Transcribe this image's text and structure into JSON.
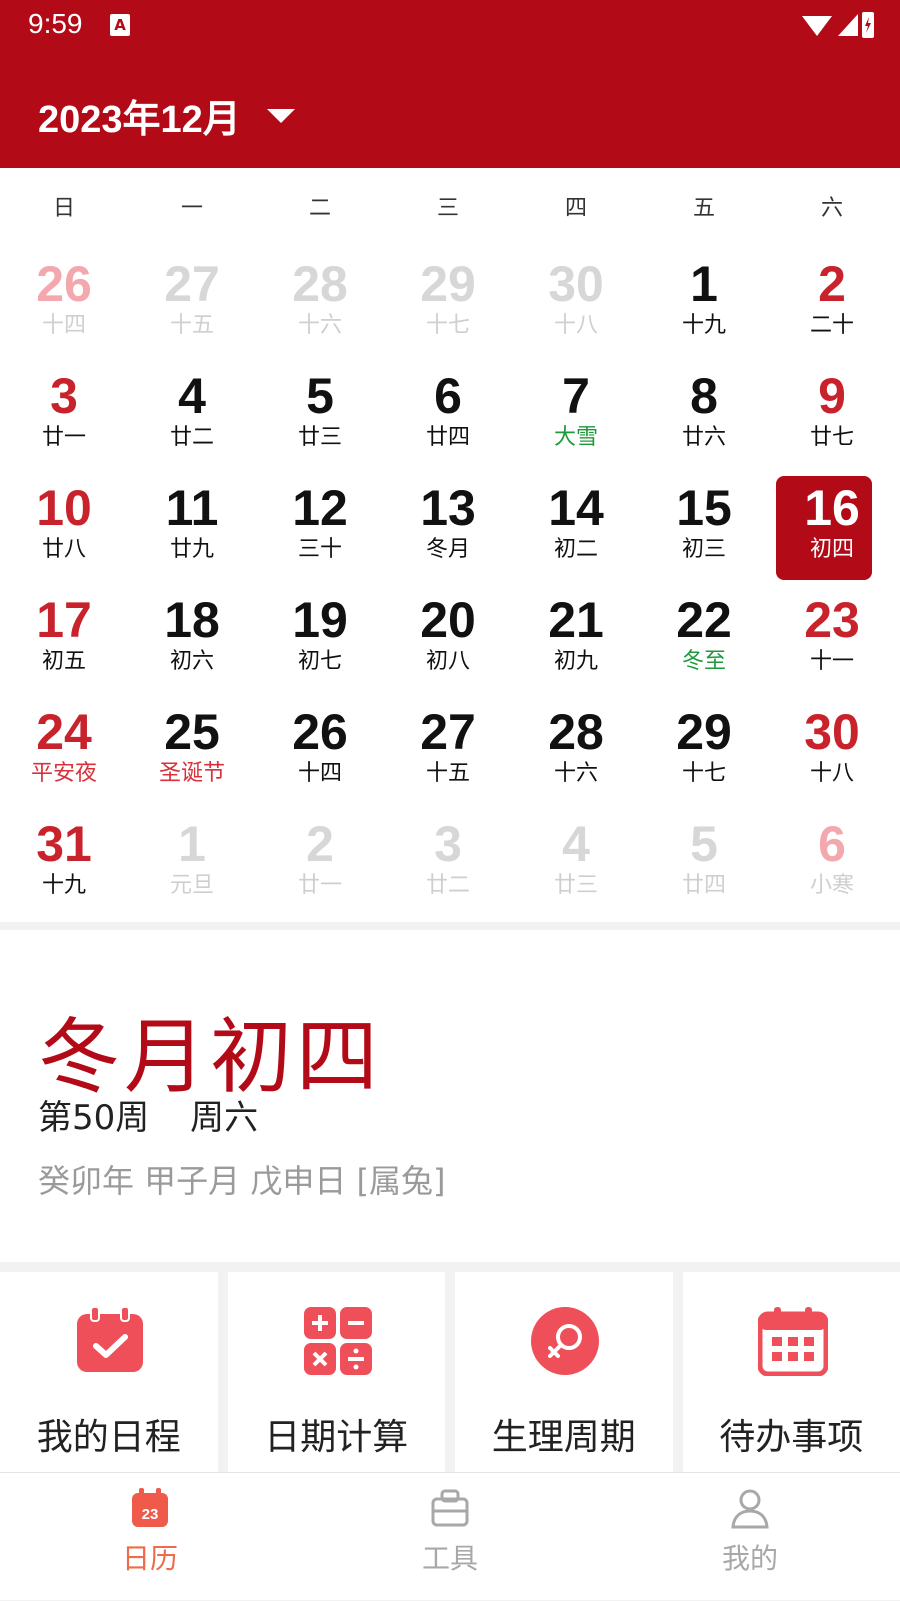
{
  "status_bar": {
    "time": "9:59",
    "notification_icon_letter": "A"
  },
  "header": {
    "month_title": "2023年12月"
  },
  "weekdays": [
    "日",
    "一",
    "二",
    "三",
    "四",
    "五",
    "六"
  ],
  "weeks": [
    [
      {
        "day": "26",
        "lunar": "十四",
        "other": true
      },
      {
        "day": "27",
        "lunar": "十五",
        "other": true
      },
      {
        "day": "28",
        "lunar": "十六",
        "other": true
      },
      {
        "day": "29",
        "lunar": "十七",
        "other": true
      },
      {
        "day": "30",
        "lunar": "十八",
        "other": true
      },
      {
        "day": "1",
        "lunar": "十九"
      },
      {
        "day": "2",
        "lunar": "二十"
      }
    ],
    [
      {
        "day": "3",
        "lunar": "廿一"
      },
      {
        "day": "4",
        "lunar": "廿二"
      },
      {
        "day": "5",
        "lunar": "廿三"
      },
      {
        "day": "6",
        "lunar": "廿四"
      },
      {
        "day": "7",
        "lunar": "大雪",
        "style": "green"
      },
      {
        "day": "8",
        "lunar": "廿六"
      },
      {
        "day": "9",
        "lunar": "廿七"
      }
    ],
    [
      {
        "day": "10",
        "lunar": "廿八"
      },
      {
        "day": "11",
        "lunar": "廿九"
      },
      {
        "day": "12",
        "lunar": "三十"
      },
      {
        "day": "13",
        "lunar": "冬月"
      },
      {
        "day": "14",
        "lunar": "初二"
      },
      {
        "day": "15",
        "lunar": "初三"
      },
      {
        "day": "16",
        "lunar": "初四",
        "selected": true
      }
    ],
    [
      {
        "day": "17",
        "lunar": "初五"
      },
      {
        "day": "18",
        "lunar": "初六"
      },
      {
        "day": "19",
        "lunar": "初七"
      },
      {
        "day": "20",
        "lunar": "初八"
      },
      {
        "day": "21",
        "lunar": "初九"
      },
      {
        "day": "22",
        "lunar": "冬至",
        "style": "green"
      },
      {
        "day": "23",
        "lunar": "十一"
      }
    ],
    [
      {
        "day": "24",
        "lunar": "平安夜",
        "style": "red"
      },
      {
        "day": "25",
        "lunar": "圣诞节",
        "style": "red"
      },
      {
        "day": "26",
        "lunar": "十四"
      },
      {
        "day": "27",
        "lunar": "十五"
      },
      {
        "day": "28",
        "lunar": "十六"
      },
      {
        "day": "29",
        "lunar": "十七"
      },
      {
        "day": "30",
        "lunar": "十八"
      }
    ],
    [
      {
        "day": "31",
        "lunar": "十九"
      },
      {
        "day": "1",
        "lunar": "元旦",
        "other": true
      },
      {
        "day": "2",
        "lunar": "廿一",
        "other": true
      },
      {
        "day": "3",
        "lunar": "廿二",
        "other": true
      },
      {
        "day": "4",
        "lunar": "廿三",
        "other": true
      },
      {
        "day": "5",
        "lunar": "廿四",
        "other": true
      },
      {
        "day": "6",
        "lunar": "小寒",
        "other": true
      }
    ]
  ],
  "info": {
    "lunar_date": "冬月初四",
    "week_number": "第50周",
    "weekday": "周六",
    "ganzhi": "癸卯年 甲子月 戊申日 [属兔]"
  },
  "tools": [
    {
      "label": "我的日程",
      "icon": "calendar-check-icon"
    },
    {
      "label": "日期计算",
      "icon": "calculator-icon"
    },
    {
      "label": "生理周期",
      "icon": "female-symbol-icon"
    },
    {
      "label": "待办事项",
      "icon": "todo-calendar-icon"
    }
  ],
  "tabs": [
    {
      "label": "日历",
      "icon": "calendar-23-icon",
      "icon_text": "23",
      "active": true
    },
    {
      "label": "工具",
      "icon": "toolbox-icon"
    },
    {
      "label": "我的",
      "icon": "person-icon"
    }
  ],
  "colors": {
    "brand": "#b30a18",
    "weekend": "#c8232d",
    "solar_term": "#1e9a3c",
    "tool_icon": "#ee4f58",
    "active_tab": "#ef6b4a"
  }
}
